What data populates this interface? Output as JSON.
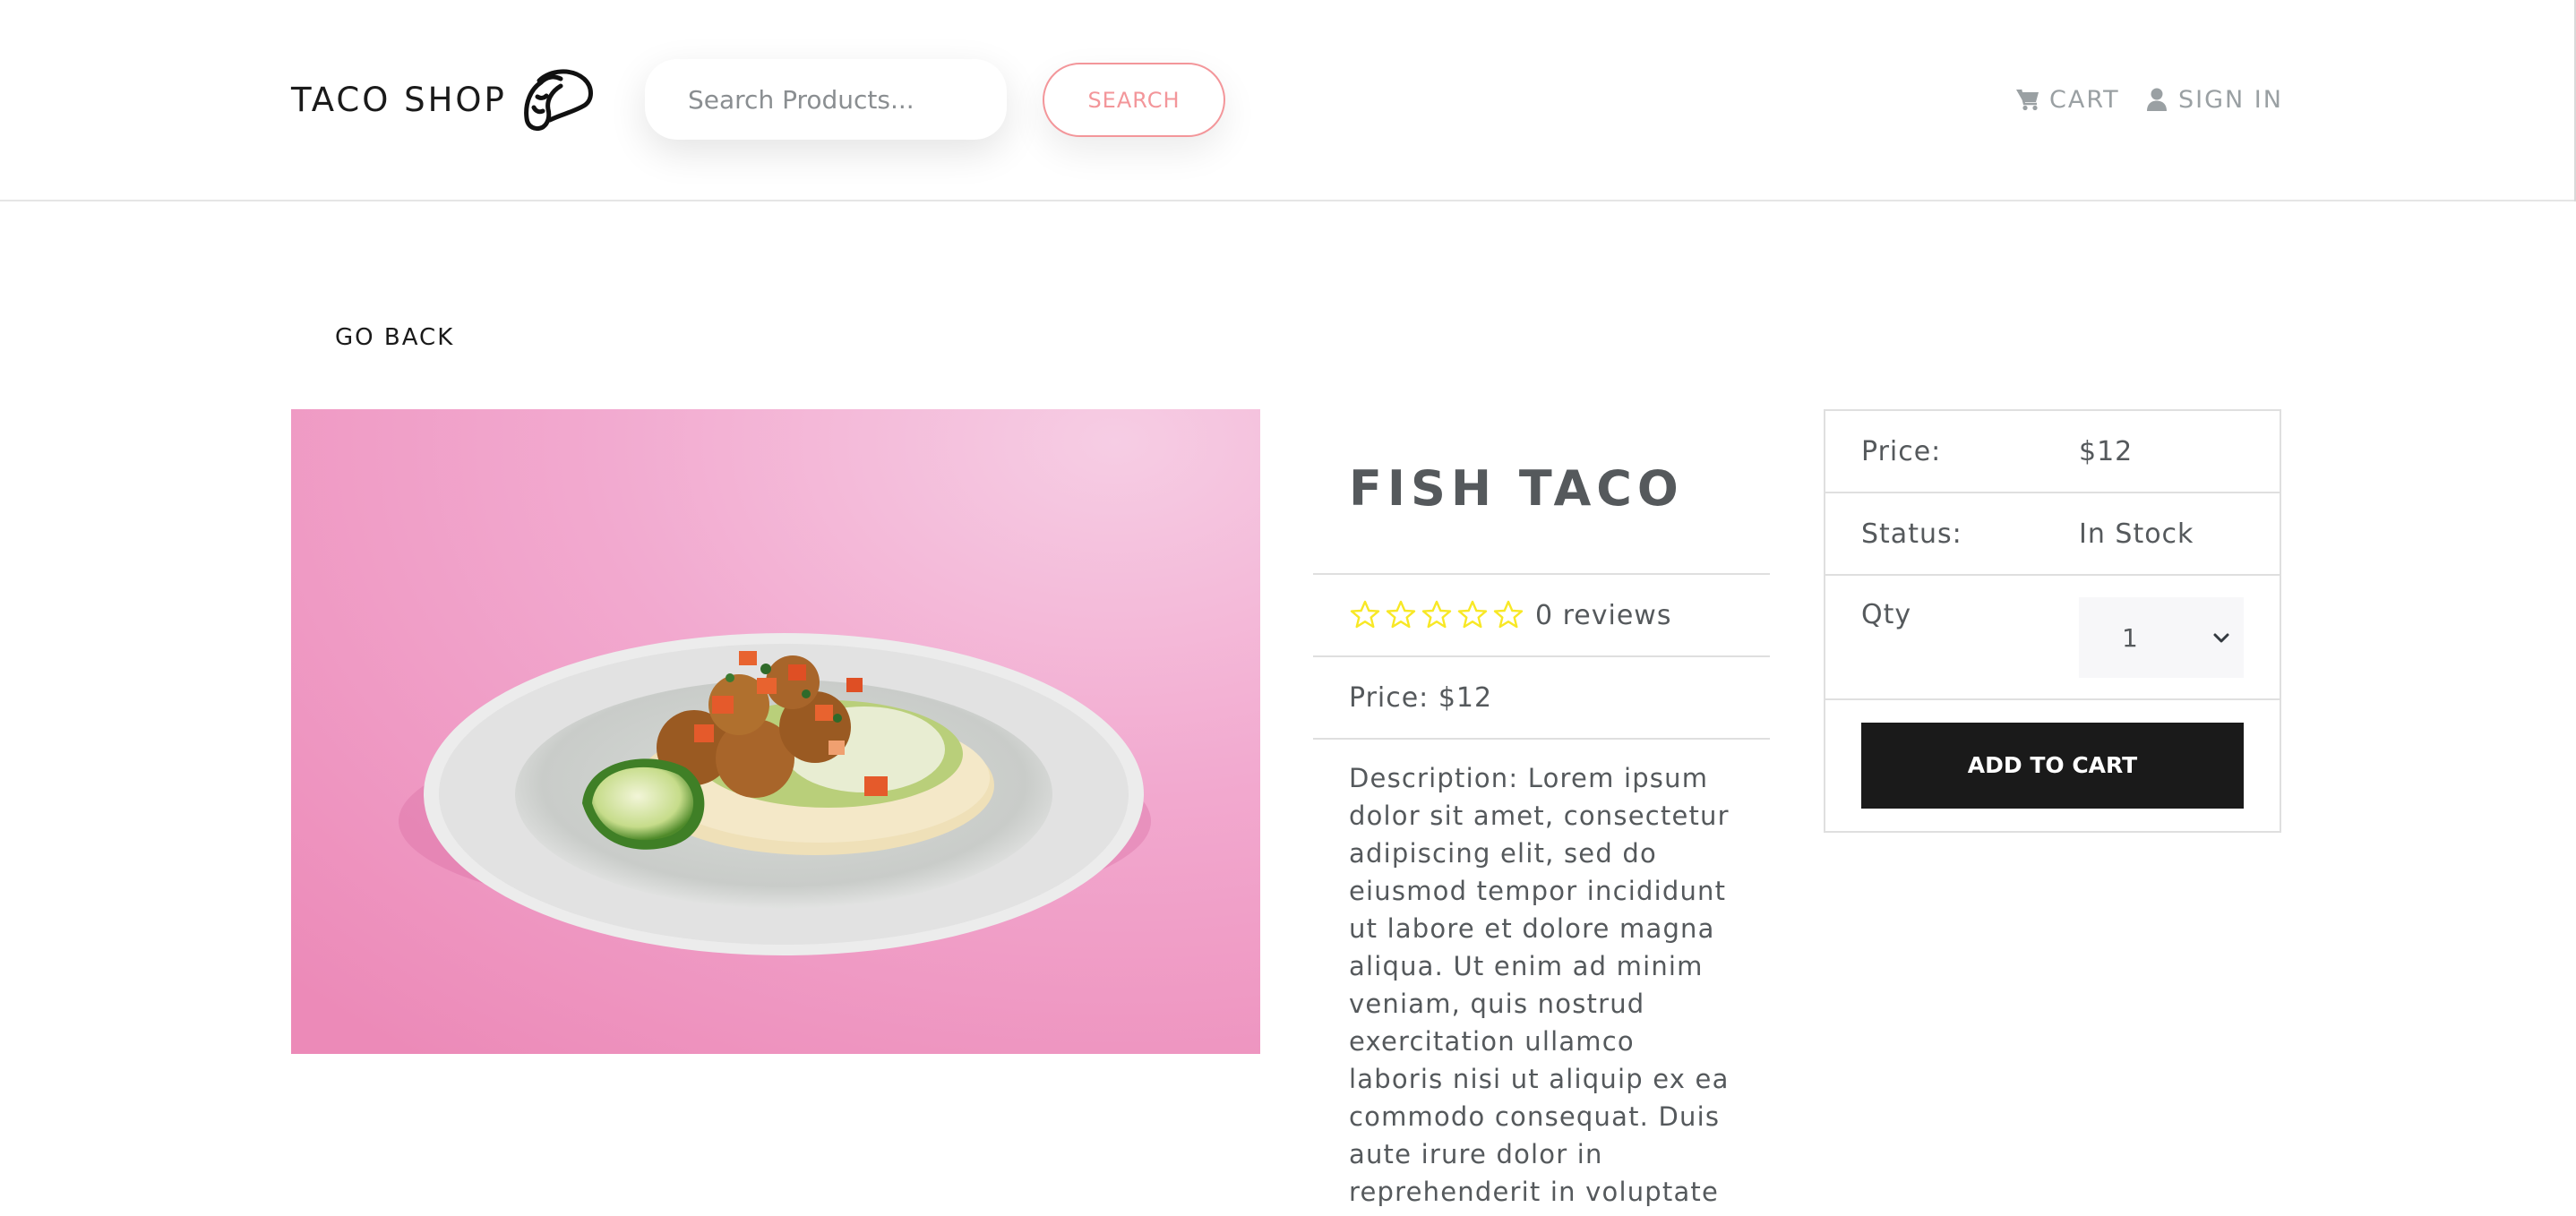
{
  "navbar": {
    "brand": "TACO SHOP",
    "search_placeholder": "Search Products...",
    "search_label": "SEARCH",
    "cart_label": "CART",
    "signin_label": "SIGN IN"
  },
  "go_back_label": "GO BACK",
  "product": {
    "name": "FISH TACO",
    "rating_stars": 0,
    "rating_max": 5,
    "reviews_text": "0 reviews",
    "price_text": "Price: $12",
    "description": "Description: Lorem ipsum dolor sit amet, consectetur adipiscing elit, sed do eiusmod tempor incididunt ut labore et dolore magna aliqua. Ut enim ad minim veniam, quis nostrud exercitation ullamco laboris nisi ut aliquip ex ea commodo consequat. Duis aute irure dolor in reprehenderit in voluptate velit esse cillum"
  },
  "cart_card": {
    "price_label": "Price:",
    "price_value": "$12",
    "status_label": "Status:",
    "status_value": "In Stock",
    "qty_label": "Qty",
    "qty_value": "1",
    "add_label": "ADD TO CART"
  },
  "colors": {
    "accent": "#f3969a",
    "star": "#f8e825",
    "dark": "#1a1a1a",
    "text": "#55595c"
  },
  "icons": {
    "brand": "taco-icon",
    "cart": "shopping-cart-icon",
    "signin": "user-icon",
    "star": "star-outline-icon",
    "select": "chevron-down-icon"
  }
}
